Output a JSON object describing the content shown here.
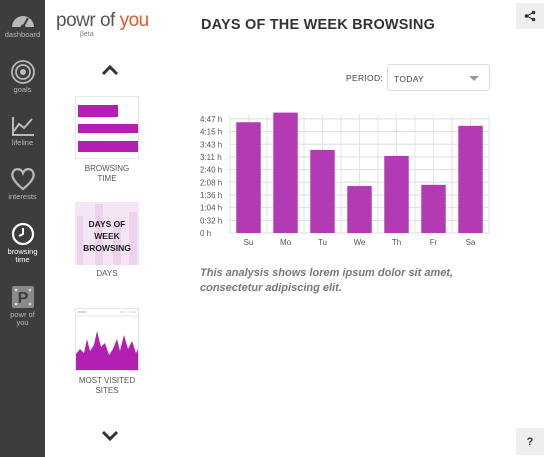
{
  "leftnav": {
    "items": [
      {
        "label": "dashboard",
        "icon": "dashboard-icon"
      },
      {
        "label": "goals",
        "icon": "goals-icon"
      },
      {
        "label": "lifeline",
        "icon": "lifeline-icon"
      },
      {
        "label": "interests",
        "icon": "heart-icon"
      },
      {
        "label1": "browsing",
        "label2": "time",
        "icon": "clock-icon"
      },
      {
        "label1": "powr of",
        "label2": "you",
        "icon": "powr-of-you-icon"
      }
    ]
  },
  "header": {
    "logo_powr": "powr",
    "logo_of": "of",
    "logo_you": "you",
    "logo_beta": "βeta",
    "title": "DAYS OF THE WEEK BROWSING"
  },
  "carousel": {
    "items": [
      {
        "label1": "BROWSING",
        "label2": "TIME"
      },
      {
        "overlay1": "DAYS OF",
        "overlay2": "WEEK",
        "overlay3": "BROWSING",
        "label": "DAYS"
      },
      {
        "label1": "MOST VISITED",
        "label2": "SITES"
      }
    ]
  },
  "period": {
    "label": "PERIOD:",
    "value": "TODAY"
  },
  "chart_data": {
    "type": "bar",
    "categories": [
      "Su",
      "Mo",
      "Tu",
      "We",
      "Th",
      "Fr",
      "Sa"
    ],
    "values": [
      4.6,
      5.0,
      3.45,
      1.95,
      3.2,
      2.0,
      4.45
    ],
    "y_ticks": [
      "0 h",
      "0:32 h",
      "1:04 h",
      "1:36 h",
      "2:08 h",
      "2:40 h",
      "3:11 h",
      "3:43 h",
      "4:15 h",
      "4:47 h"
    ],
    "ylim": [
      0,
      4.9
    ],
    "bar_color": "#b23ab3",
    "grid": true
  },
  "caption": "This analysis shows lorem ipsum dolor sit amet, consectetur adipiscing elit.",
  "help_label": "?",
  "colors": {
    "accent": "#b31fb3",
    "sidebar_bg": "#3d3d3d",
    "logo_orange": "#e8552a"
  }
}
